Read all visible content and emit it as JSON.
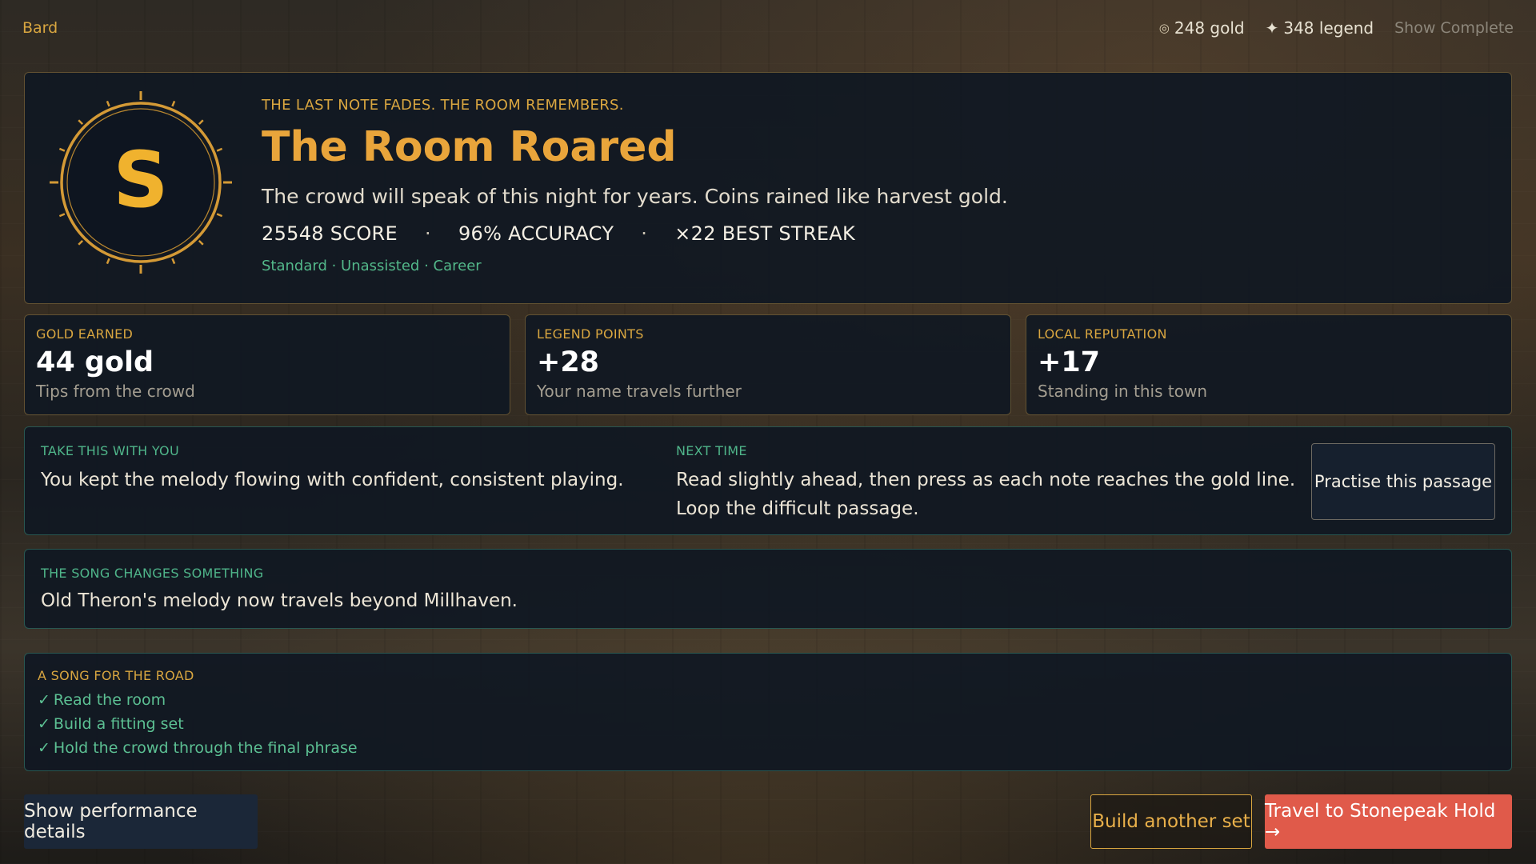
{
  "topbar": {
    "brand": "Bard",
    "gold": "248 gold",
    "gold_icon": "coin-icon",
    "legend": "348 legend",
    "legend_icon": "star-icon",
    "show_complete": "Show Complete"
  },
  "hero": {
    "grade": "S",
    "kicker": "THE LAST NOTE FADES. THE ROOM REMEMBERS.",
    "title": "The Room Roared",
    "description": "The crowd will speak of this night for years. Coins rained like harvest gold.",
    "score": "25548 SCORE",
    "accuracy": "96% ACCURACY",
    "streak": "×22 BEST STREAK",
    "separator": "·",
    "tags": "Standard · Unassisted · Career"
  },
  "rewards": [
    {
      "label": "GOLD EARNED",
      "value": "44 gold",
      "sub": "Tips from the crowd"
    },
    {
      "label": "LEGEND POINTS",
      "value": "+28",
      "sub": "Your name travels further"
    },
    {
      "label": "LOCAL REPUTATION",
      "value": "+17",
      "sub": "Standing in this town"
    }
  ],
  "advice": {
    "take_label": "TAKE THIS WITH YOU",
    "take_text": "You kept the melody flowing with confident, consistent playing.",
    "next_label": "NEXT TIME",
    "next_text_1": "Read slightly ahead, then press as each note reaches the gold line.",
    "next_text_2": "Loop the difficult passage.",
    "practise_button": "Practise this passage"
  },
  "changes": {
    "label": "THE SONG CHANGES SOMETHING",
    "text": "Old Theron's melody now travels beyond Millhaven."
  },
  "road": {
    "label": "A SONG FOR THE ROAD",
    "check": "✓",
    "items": [
      "Read the room",
      "Build a fitting set",
      "Hold the crowd through the final phrase"
    ]
  },
  "buttons": {
    "details": "Show performance details",
    "build": "Build another set",
    "travel": "Travel to Stonepeak Hold →"
  },
  "colors": {
    "gold_accent": "#d9a640",
    "teal_accent": "#53b88a",
    "travel_button": "#e05a4a",
    "panel_bg": "#101822"
  }
}
